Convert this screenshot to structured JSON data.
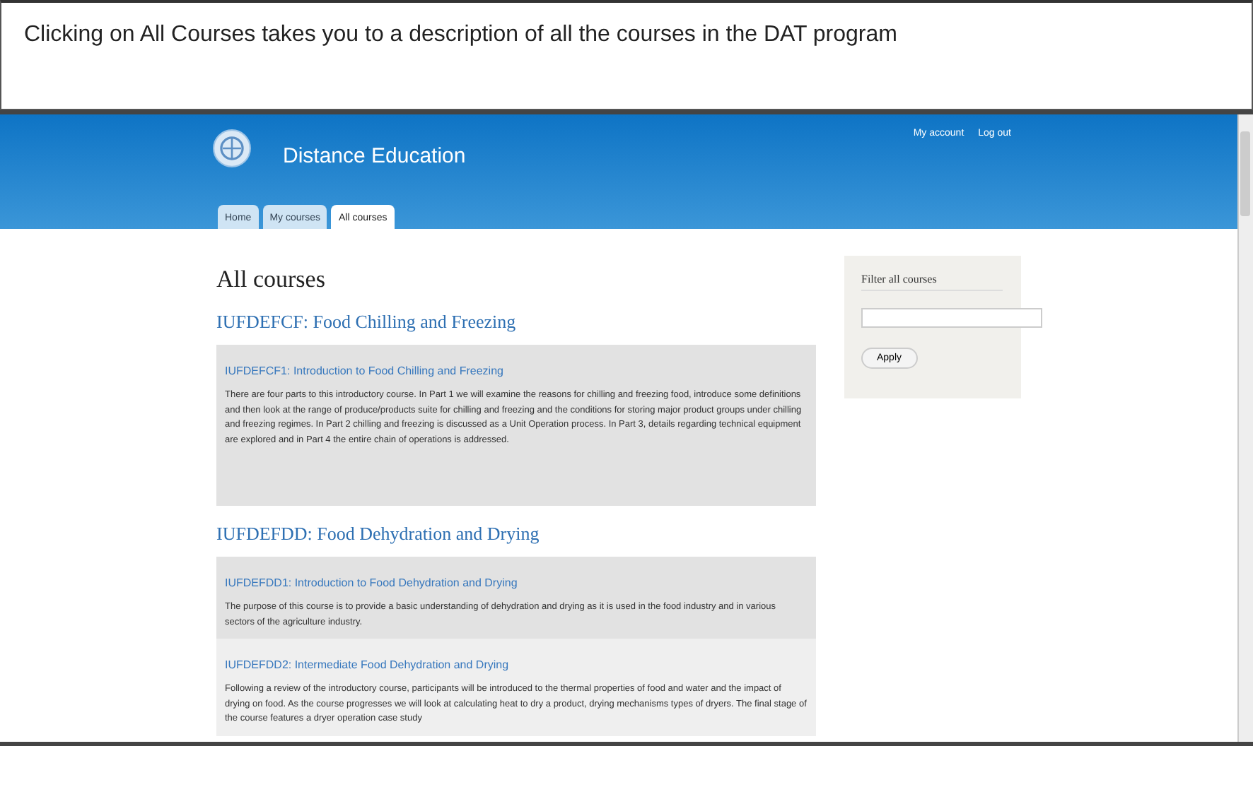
{
  "caption": "Clicking on All Courses takes you to a description of all the courses in the DAT program",
  "site": {
    "title": "Distance Education",
    "user_links": [
      "My account",
      "Log out"
    ]
  },
  "tabs": [
    {
      "label": "Home",
      "selected": false
    },
    {
      "label": "My courses",
      "selected": false
    },
    {
      "label": "All courses",
      "selected": true
    }
  ],
  "heading": "All courses",
  "groups": [
    {
      "title": "IUFDEFCF: Food Chilling and Freezing",
      "courses": [
        {
          "title": "IUFDEFCF1: Introduction to Food Chilling and Freezing",
          "description": "There are four parts to this introductory course. In Part 1 we will examine the reasons for chilling and freezing food, introduce some definitions and then look at the range of produce/products suite for chilling and freezing and the conditions for storing major product groups under chilling and freezing regimes. In Part 2 chilling and freezing is discussed as a Unit Operation process. In Part 3, details regarding technical equipment are explored and in Part 4 the entire chain of operations is addressed."
        }
      ]
    },
    {
      "title": "IUFDEFDD: Food Dehydration and Drying",
      "courses": [
        {
          "title": "IUFDEFDD1: Introduction to Food Dehydration and Drying",
          "description": "The purpose of this course is to provide a basic understanding of dehydration and drying as it is used in the food industry and in various sectors of the agriculture industry."
        },
        {
          "title": "IUFDEFDD2: Intermediate Food Dehydration and Drying",
          "description": "Following a review of the introductory course, participants will be introduced to the thermal properties of food and water and the impact of drying on food. As the course progresses we will look at calculating heat to dry a product, drying mechanisms types of dryers. The final stage of the course features a dryer operation case study"
        }
      ]
    }
  ],
  "filter": {
    "title": "Filter all courses",
    "button": "Apply"
  }
}
